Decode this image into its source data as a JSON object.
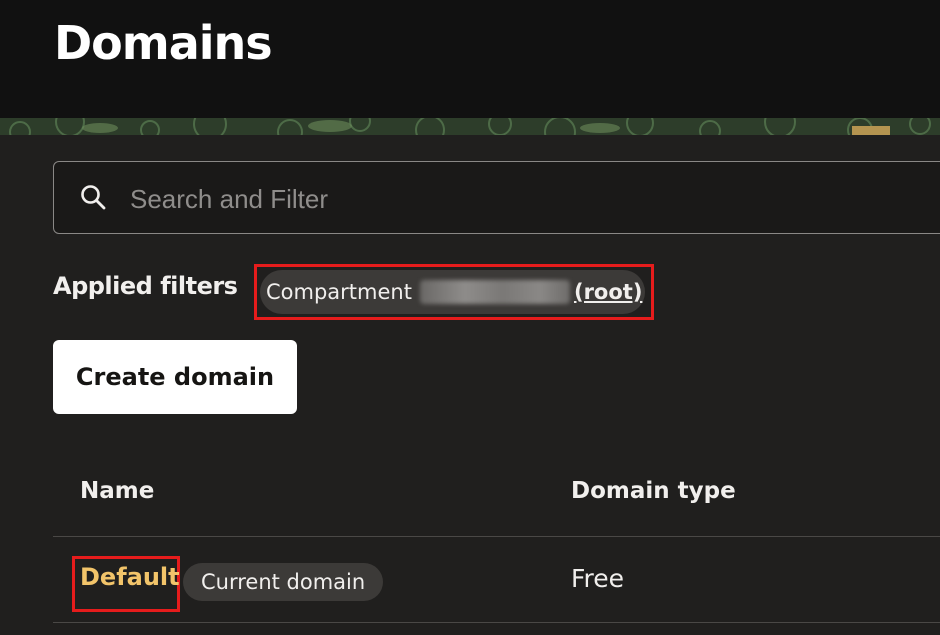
{
  "header": {
    "title": "Domains"
  },
  "search": {
    "placeholder": "Search and Filter",
    "value": ""
  },
  "filters": {
    "label": "Applied filters",
    "chips": [
      {
        "label": "Compartment",
        "value": "[redacted]",
        "suffix": "(root)"
      }
    ]
  },
  "toolbar": {
    "create_label": "Create domain"
  },
  "table": {
    "columns": [
      "Name",
      "Domain type"
    ],
    "rows": [
      {
        "name": "Default",
        "badge": "Current domain",
        "type": "Free"
      }
    ]
  },
  "colors": {
    "background": "#201f1e",
    "header": "#111111",
    "link": "#f2c46a",
    "highlight": "#e61c1c",
    "button": "#ffffff"
  }
}
